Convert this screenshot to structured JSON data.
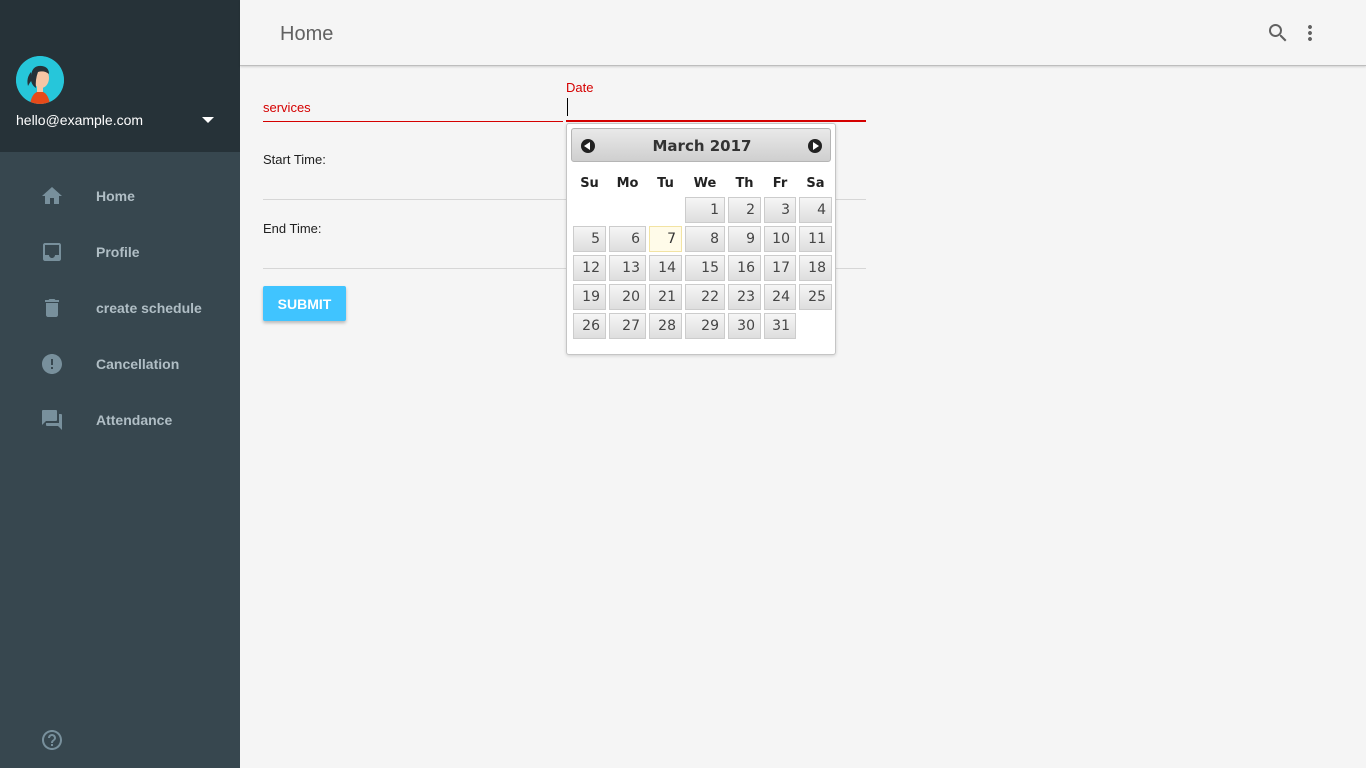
{
  "account": {
    "email": "hello@example.com"
  },
  "nav": {
    "items": [
      {
        "label": "Home",
        "icon": "home-icon"
      },
      {
        "label": "Profile",
        "icon": "inbox-icon"
      },
      {
        "label": "create schedule",
        "icon": "delete-icon"
      },
      {
        "label": "Cancellation",
        "icon": "alert-icon"
      },
      {
        "label": "Attendance",
        "icon": "forum-icon"
      }
    ]
  },
  "header": {
    "title": "Home"
  },
  "form": {
    "services_label": "services",
    "date_label": "Date",
    "date_value": "",
    "start_time_label": "Start Time:",
    "end_time_label": "End Time:",
    "submit_label": "SUBMIT"
  },
  "datepicker": {
    "title": "March 2017",
    "weekdays": [
      "Su",
      "Mo",
      "Tu",
      "We",
      "Th",
      "Fr",
      "Sa"
    ],
    "weeks": [
      [
        "",
        "",
        "",
        "1",
        "2",
        "3",
        "4"
      ],
      [
        "5",
        "6",
        "7",
        "8",
        "9",
        "10",
        "11"
      ],
      [
        "12",
        "13",
        "14",
        "15",
        "16",
        "17",
        "18"
      ],
      [
        "19",
        "20",
        "21",
        "22",
        "23",
        "24",
        "25"
      ],
      [
        "26",
        "27",
        "28",
        "29",
        "30",
        "31",
        ""
      ]
    ],
    "today": "7"
  },
  "colors": {
    "sidebar": "#37474f",
    "sidebar_header": "#263238",
    "accent": "#40c4ff",
    "error": "#d50000"
  }
}
